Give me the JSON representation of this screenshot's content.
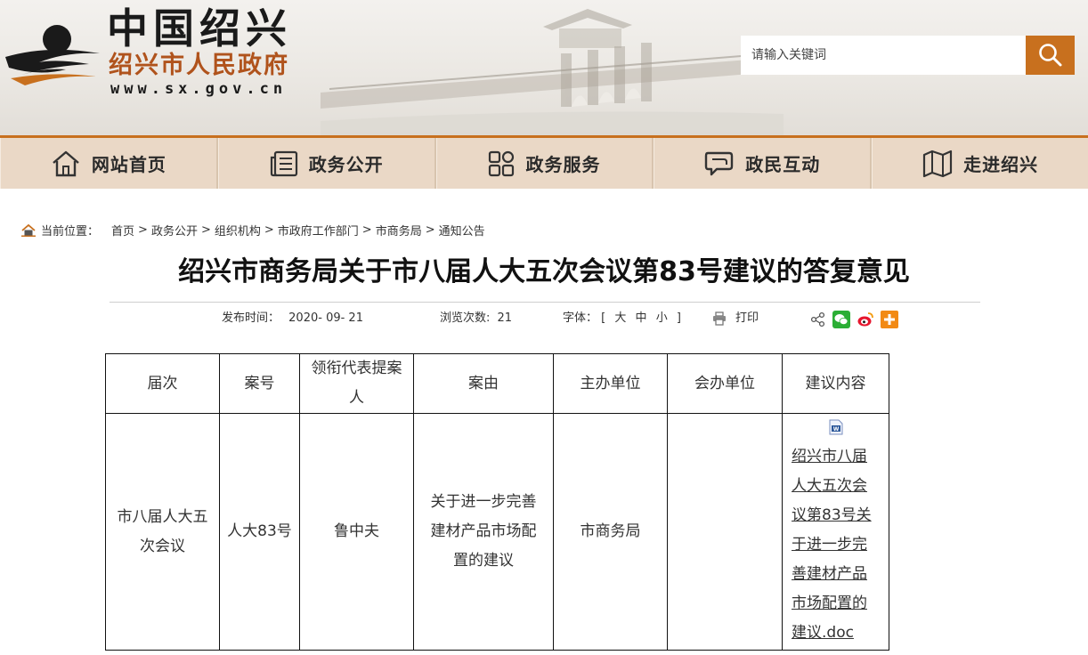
{
  "header": {
    "logo_title": "中国绍兴",
    "logo_sub": "绍兴市人民政府",
    "logo_url": "www.sx.gov.cn",
    "search_placeholder": "请输入关键词",
    "accent_color": "#c8701e"
  },
  "nav": {
    "items": [
      {
        "label": "网站首页",
        "icon": "home-icon"
      },
      {
        "label": "政务公开",
        "icon": "news-icon"
      },
      {
        "label": "政务服务",
        "icon": "grid-icon"
      },
      {
        "label": "政民互动",
        "icon": "chat-icon"
      },
      {
        "label": "走进绍兴",
        "icon": "map-icon"
      }
    ]
  },
  "breadcrumb": {
    "label": "当前位置：",
    "items": [
      "首页",
      "政务公开",
      "组织机构",
      "市政府工作部门",
      "市商务局",
      "通知公告"
    ],
    "separator": ">"
  },
  "article": {
    "title": "绍兴市商务局关于市八届人大五次会议第83号建议的答复意见",
    "publish_label": "发布时间：",
    "publish_date": "2020- 09- 21",
    "views_label": "浏览次数:",
    "views_count": "21",
    "font_label": "字体：",
    "font_open": "[",
    "font_large": "大",
    "font_medium": "中",
    "font_small": "小",
    "font_close": "]",
    "print_label": "打印"
  },
  "table": {
    "headers": [
      "届次",
      "案号",
      "领衔代表提案人",
      "案由",
      "主办单位",
      "会办单位",
      "建议内容"
    ],
    "row": {
      "session": "市八届人大五次会议",
      "case_no": "人大83号",
      "proposer": "鲁中夫",
      "subject": "关于进一步完善建材产品市场配置的建议",
      "host_unit": "市商务局",
      "co_unit": "",
      "attachment": "绍兴市八届人大五次会议第83号关于进一步完善建材产品市场配置的建议.doc"
    }
  }
}
